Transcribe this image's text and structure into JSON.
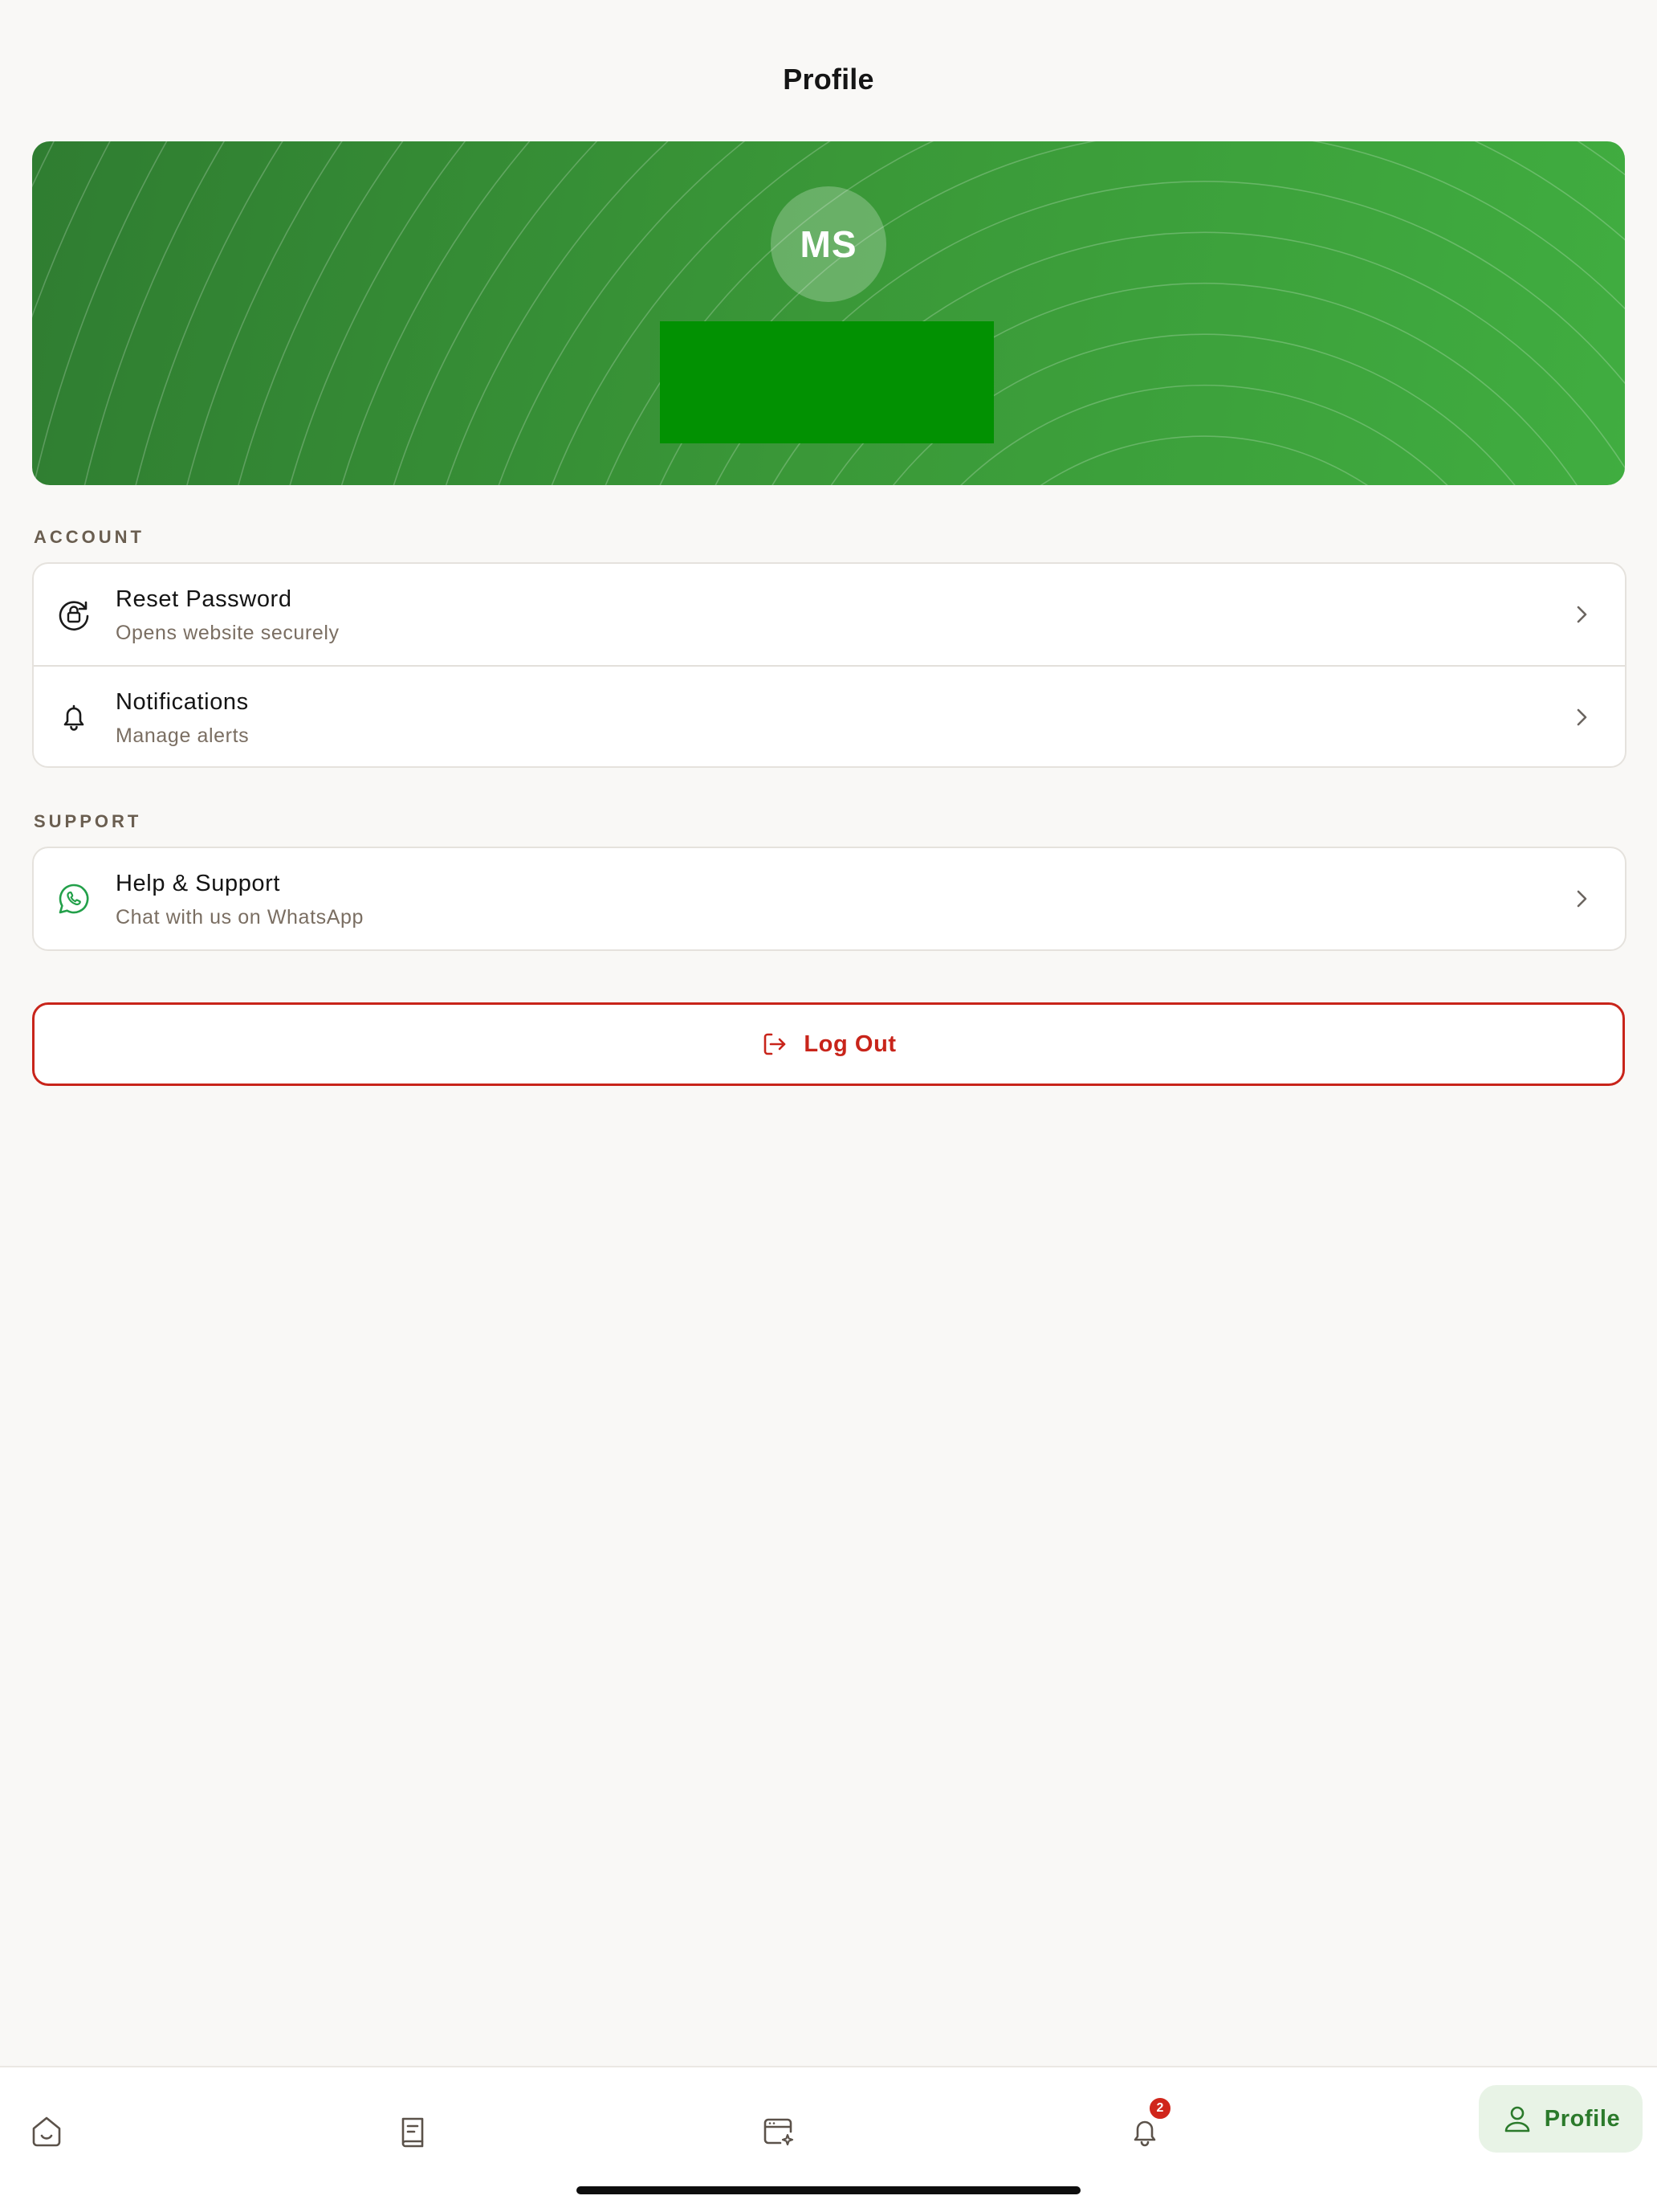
{
  "header": {
    "title": "Profile"
  },
  "profile": {
    "initials": "MS"
  },
  "account": {
    "section_label": "ACCOUNT",
    "items": [
      {
        "title": "Reset Password",
        "subtitle": "Opens website securely",
        "icon": "lock-refresh-icon"
      },
      {
        "title": "Notifications",
        "subtitle": "Manage alerts",
        "icon": "bell-icon"
      }
    ]
  },
  "support": {
    "section_label": "SUPPORT",
    "items": [
      {
        "title": "Help & Support",
        "subtitle": "Chat with us on WhatsApp",
        "icon": "whatsapp-icon"
      }
    ]
  },
  "logout": {
    "label": "Log Out",
    "icon": "logout-icon"
  },
  "tabbar": {
    "tabs": [
      {
        "name": "home",
        "icon": "home-icon"
      },
      {
        "name": "book",
        "icon": "book-icon"
      },
      {
        "name": "ai-browser",
        "icon": "sparkle-window-icon"
      },
      {
        "name": "notifications",
        "icon": "bell-icon",
        "badge": "2"
      },
      {
        "name": "profile",
        "icon": "user-icon",
        "label": "Profile",
        "active": true
      }
    ]
  },
  "colors": {
    "brand_green": "#2b7a2b",
    "hero_green_dark": "#2f7d31",
    "hero_green_light": "#40ad40",
    "danger_red": "#c8241a",
    "background": "#f9f8f6"
  }
}
